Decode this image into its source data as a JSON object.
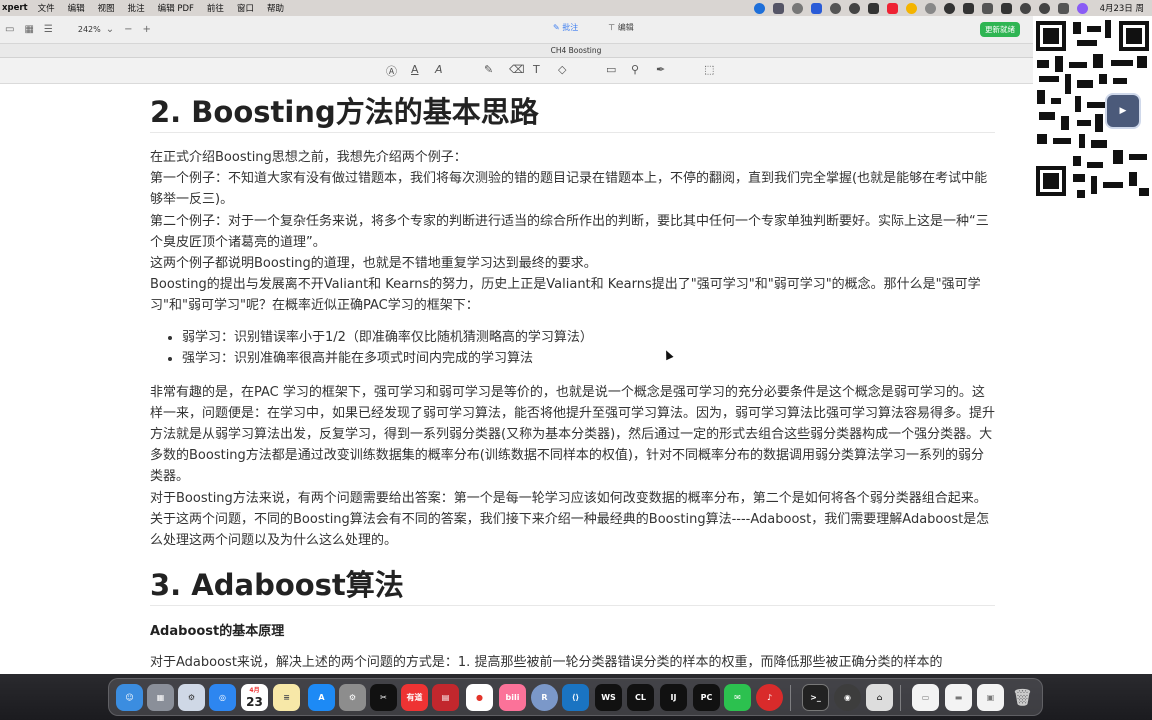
{
  "menubar": {
    "app": "xpert",
    "items": [
      "文件",
      "编辑",
      "视图",
      "批注",
      "编辑 PDF",
      "前往",
      "窗口",
      "帮助"
    ],
    "clock": "4月23日 周"
  },
  "toolbar": {
    "zoom": "242%",
    "annotate_tab": "批注",
    "edit_tab": "编辑",
    "update_button": "更新就绪"
  },
  "document": {
    "title": "CH4 Boosting",
    "heading_2": "2. Boosting方法的基本思路",
    "paragraphs_1": [
      "在正式介绍Boosting思想之前，我想先介绍两个例子：",
      "第一个例子：不知道大家有没有做过错题本，我们将每次测验的错的题目记录在错题本上，不停的翻阅，直到我们完全掌握(也就是能够在考试中能够举一反三)。",
      "第二个例子：对于一个复杂任务来说，将多个专家的判断进行适当的综合所作出的判断，要比其中任何一个专家单独判断要好。实际上这是一种“三个臭皮匠顶个诸葛亮的道理”。",
      "这两个例子都说明Boosting的道理，也就是不错地重复学习达到最终的要求。",
      "Boosting的提出与发展离不开Valiant和 Kearns的努力，历史上正是Valiant和 Kearns提出了\"强可学习\"和\"弱可学习\"的概念。那什么是\"强可学习\"和\"弱可学习\"呢？在概率近似正确PAC学习的框架下："
    ],
    "bullets": [
      "弱学习：识别错误率小于1/2（即准确率仅比随机猜测略高的学习算法）",
      "强学习：识别准确率很高并能在多项式时间内完成的学习算法"
    ],
    "paragraphs_2": [
      "非常有趣的是，在PAC 学习的框架下，强可学习和弱可学习是等价的，也就是说一个概念是强可学习的充分必要条件是这个概念是弱可学习的。这样一来，问题便是：在学习中，如果已经发现了弱可学习算法，能否将他提升至强可学习算法。因为，弱可学习算法比强可学习算法容易得多。提升方法就是从弱学习算法出发，反复学习，得到一系列弱分类器(又称为基本分类器)，然后通过一定的形式去组合这些弱分类器构成一个强分类器。大多数的Boosting方法都是通过改变训练数据集的概率分布(训练数据不同样本的权值)，针对不同概率分布的数据调用弱分类算法学习一系列的弱分类器。",
      "对于Boosting方法来说，有两个问题需要给出答案：第一个是每一轮学习应该如何改变数据的概率分布，第二个是如何将各个弱分类器组合起来。关于这两个问题，不同的Boosting算法会有不同的答案，我们接下来介绍一种最经典的Boosting算法----Adaboost，我们需要理解Adaboost是怎么处理这两个问题以及为什么这么处理的。"
    ],
    "heading_3": "3. Adaboost算法",
    "subheading": "Adaboost的基本原理",
    "paragraph_3": "对于Adaboost来说，解决上述的两个问题的方式是：1. 提高那些被前一轮分类器错误分类的样本的权重，而降低那些被正确分类的样本的"
  },
  "dock": {
    "calendar_month": "4月",
    "calendar_day": "23",
    "labels": [
      "有道",
      "bili",
      "R",
      "WS",
      "CL",
      "IJ",
      "PC"
    ]
  },
  "colors": {
    "accent": "#3c7df0",
    "update": "#2fb553"
  }
}
